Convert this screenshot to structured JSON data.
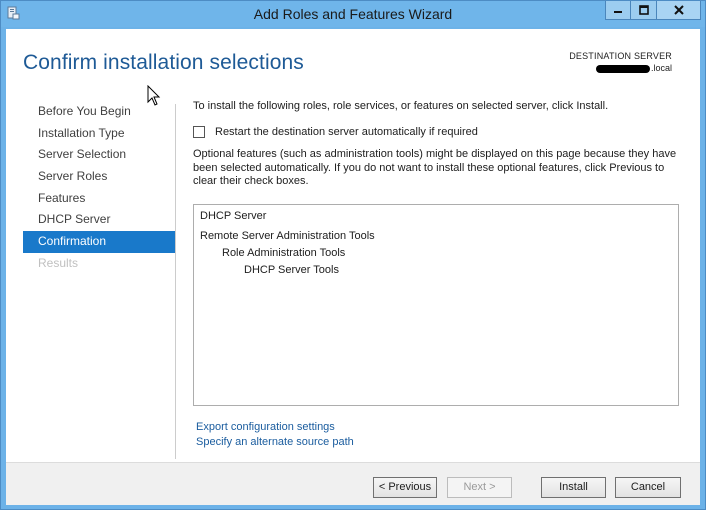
{
  "window": {
    "title": "Add Roles and Features Wizard"
  },
  "header": {
    "page_title": "Confirm installation selections",
    "destination_label": "DESTINATION SERVER",
    "destination_value": ".local"
  },
  "nav": {
    "items": [
      {
        "label": "Before You Begin",
        "state": "normal"
      },
      {
        "label": "Installation Type",
        "state": "normal"
      },
      {
        "label": "Server Selection",
        "state": "normal"
      },
      {
        "label": "Server Roles",
        "state": "normal"
      },
      {
        "label": "Features",
        "state": "normal"
      },
      {
        "label": "DHCP Server",
        "state": "normal"
      },
      {
        "label": "Confirmation",
        "state": "active"
      },
      {
        "label": "Results",
        "state": "disabled"
      }
    ]
  },
  "main": {
    "intro": "To install the following roles, role services, or features on selected server, click Install.",
    "restart_label": "Restart the destination server automatically if required",
    "restart_checked": false,
    "optional_text": "Optional features (such as administration tools) might be displayed on this page because they have been selected automatically. If you do not want to install these optional features, click Previous to clear their check boxes.",
    "selections": [
      {
        "label": "DHCP Server",
        "level": 0
      },
      {
        "label": "Remote Server Administration Tools",
        "level": 0
      },
      {
        "label": "Role Administration Tools",
        "level": 1
      },
      {
        "label": "DHCP Server Tools",
        "level": 2
      }
    ],
    "export_link": "Export configuration settings",
    "alternate_link": "Specify an alternate source path"
  },
  "footer": {
    "previous_label": "< Previous",
    "next_label": "Next >",
    "install_label": "Install",
    "cancel_label": "Cancel"
  },
  "colors": {
    "titlebar": "#6fb5ea",
    "accent": "#1979ca",
    "title_text": "#1e5a96",
    "link": "#1a5c9e"
  }
}
